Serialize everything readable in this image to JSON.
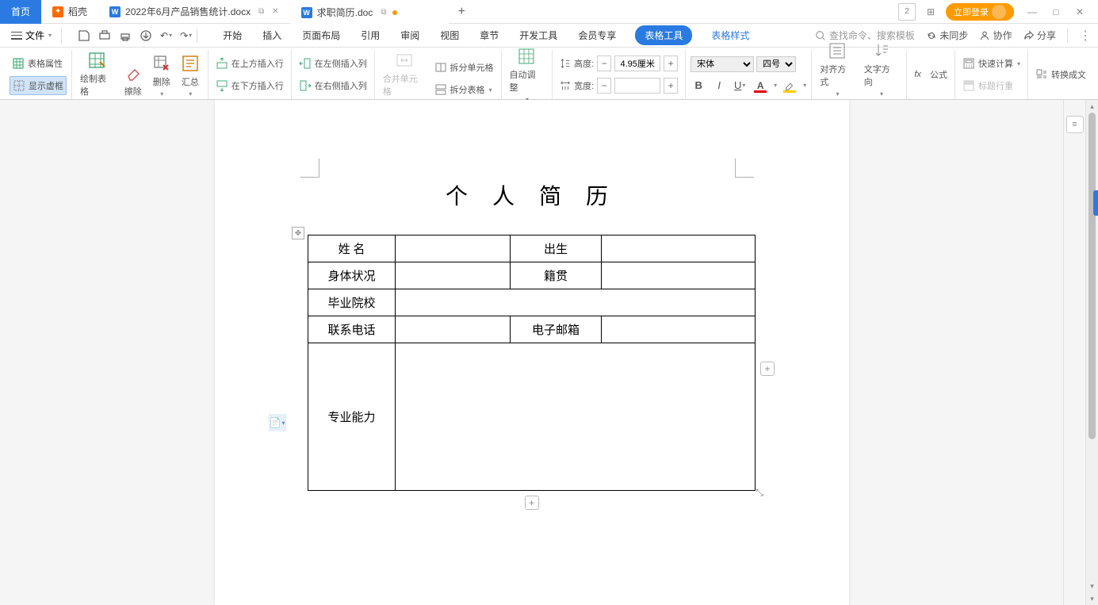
{
  "tabs": {
    "home": "首页",
    "docker": "稻壳",
    "doc1": "2022年6月产品销售统计.docx",
    "doc2": "求职简历.doc"
  },
  "titlebar": {
    "login": "立即登录",
    "skin_count": "2"
  },
  "menubar": {
    "file": "文件",
    "tabs": {
      "start": "开始",
      "insert": "插入",
      "layout": "页面布局",
      "reference": "引用",
      "review": "审阅",
      "view": "视图",
      "section": "章节",
      "dev": "开发工具",
      "member": "会员专享",
      "table_tools": "表格工具",
      "table_style": "表格样式"
    },
    "search_placeholder": "查找命令、搜索模板",
    "unsync": "未同步",
    "collab": "协作",
    "share": "分享"
  },
  "ribbon": {
    "table_props": "表格属性",
    "show_frame": "显示虚框",
    "draw": "绘制表格",
    "erase": "擦除",
    "delete": "删除",
    "summary": "汇总",
    "insert_above": "在上方插入行",
    "insert_below": "在下方插入行",
    "insert_left": "在左侧插入列",
    "insert_right": "在右侧插入列",
    "merge_cells": "合并单元格",
    "split_cell": "拆分单元格",
    "split_table": "拆分表格",
    "autofit": "自动调整",
    "height": "高度:",
    "width": "宽度:",
    "height_val": "4.95厘米",
    "width_val": "",
    "font_name": "宋体",
    "font_size": "四号",
    "align": "对齐方式",
    "text_dir": "文字方向",
    "formula": "公式",
    "quick_calc": "快速计算",
    "title_repeat": "标题行重",
    "convert": "转换成文"
  },
  "document": {
    "title": "个 人 简 历",
    "cells": {
      "name": "姓   名",
      "birth": "出生",
      "health": "身体状况",
      "native": "籍贯",
      "school": "毕业院校",
      "phone": "联系电话",
      "email": "电子邮箱",
      "skill": "专业能力"
    }
  }
}
